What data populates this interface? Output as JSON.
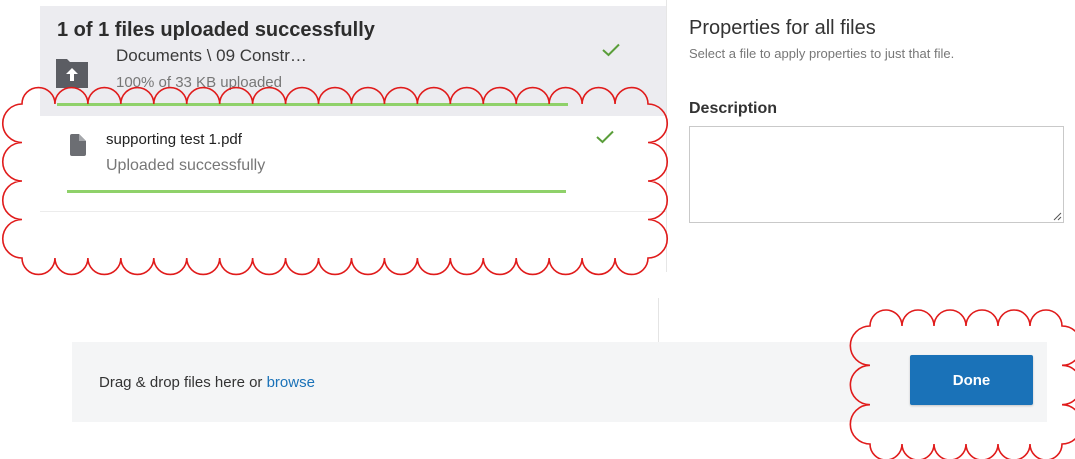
{
  "upload": {
    "summary": "1 of 1 files uploaded successfully",
    "folder": {
      "path": "Documents \\ 09 Constr…",
      "progress_text": "100% of 33 KB uploaded",
      "progress_fraction": 1.0,
      "icon": "upload-folder-icon",
      "status_icon": "checkmark-icon"
    },
    "files": [
      {
        "name": "supporting test 1.pdf",
        "status": "Uploaded successfully",
        "progress_fraction": 1.0,
        "icon": "document-icon",
        "status_icon": "checkmark-icon"
      }
    ]
  },
  "properties": {
    "title": "Properties for all files",
    "hint": "Select a file to apply properties to just that file.",
    "description_label": "Description",
    "description_value": ""
  },
  "footer": {
    "drop_text": "Drag & drop files here or ",
    "browse_label": "browse",
    "done_label": "Done"
  },
  "colors": {
    "accent": "#1a72b8",
    "success": "#5a9e3a",
    "progress": "#8fd16a",
    "annotation": "#e01b1b"
  }
}
